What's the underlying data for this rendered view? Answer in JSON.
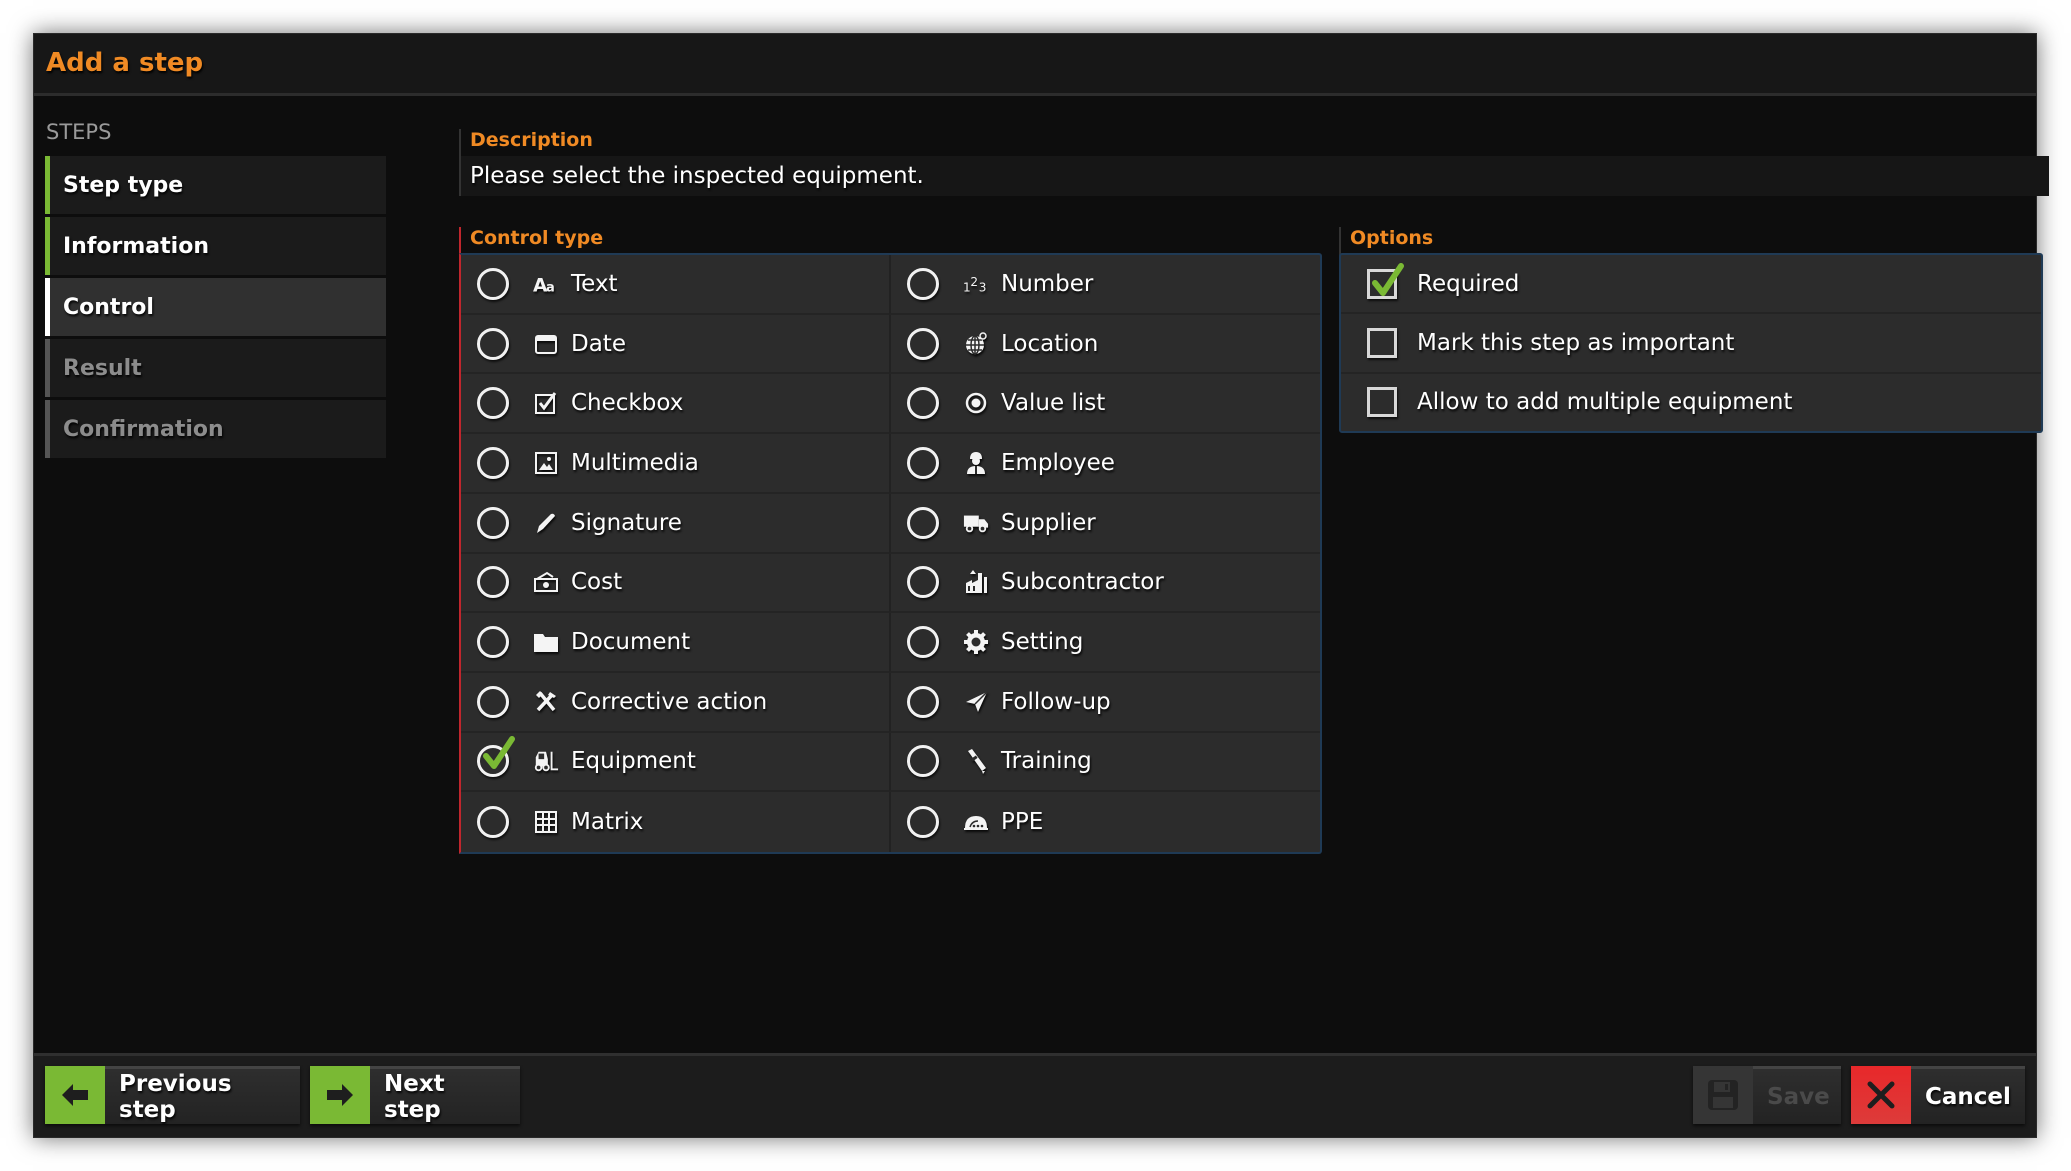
{
  "window": {
    "title": "Add a step"
  },
  "sidebar": {
    "heading": "STEPS",
    "items": [
      {
        "label": "Step type",
        "state": "done"
      },
      {
        "label": "Information",
        "state": "done"
      },
      {
        "label": "Control",
        "state": "active"
      },
      {
        "label": "Result",
        "state": "pending"
      },
      {
        "label": "Confirmation",
        "state": "pending"
      }
    ]
  },
  "description": {
    "label": "Description",
    "value": "Please select the inspected equipment."
  },
  "control_type": {
    "label": "Control type",
    "selected": "Equipment",
    "options": [
      {
        "label": "Text",
        "icon": "text-format-icon",
        "checked": false
      },
      {
        "label": "Date",
        "icon": "calendar-icon",
        "checked": false
      },
      {
        "label": "Checkbox",
        "icon": "checkbox-icon",
        "checked": false
      },
      {
        "label": "Multimedia",
        "icon": "image-icon",
        "checked": false
      },
      {
        "label": "Signature",
        "icon": "pen-icon",
        "checked": false
      },
      {
        "label": "Cost",
        "icon": "money-icon",
        "checked": false
      },
      {
        "label": "Document",
        "icon": "folder-icon",
        "checked": false
      },
      {
        "label": "Corrective action",
        "icon": "tools-icon",
        "checked": false
      },
      {
        "label": "Equipment",
        "icon": "forklift-icon",
        "checked": true
      },
      {
        "label": "Matrix",
        "icon": "grid-icon",
        "checked": false
      },
      {
        "label": "Number",
        "icon": "numbers-icon",
        "checked": false
      },
      {
        "label": "Location",
        "icon": "globe-pin-icon",
        "checked": false
      },
      {
        "label": "Value list",
        "icon": "radio-dot-icon",
        "checked": false
      },
      {
        "label": "Employee",
        "icon": "worker-icon",
        "checked": false
      },
      {
        "label": "Supplier",
        "icon": "truck-icon",
        "checked": false
      },
      {
        "label": "Subcontractor",
        "icon": "factory-icon",
        "checked": false
      },
      {
        "label": "Setting",
        "icon": "gear-icon",
        "checked": false
      },
      {
        "label": "Follow-up",
        "icon": "paper-plane-icon",
        "checked": false
      },
      {
        "label": "Training",
        "icon": "diploma-icon",
        "checked": false
      },
      {
        "label": "PPE",
        "icon": "hard-hat-icon",
        "checked": false
      }
    ]
  },
  "options": {
    "label": "Options",
    "items": [
      {
        "label": "Required",
        "checked": true
      },
      {
        "label": "Mark this step as important",
        "checked": false
      },
      {
        "label": "Allow to add multiple equipment",
        "checked": false
      }
    ]
  },
  "footer": {
    "previous_label": "Previous step",
    "next_label": "Next step",
    "save_label": "Save",
    "save_enabled": false,
    "cancel_label": "Cancel"
  },
  "colors": {
    "accent_orange": "#f08a24",
    "success_green": "#7ab934",
    "cancel_red": "#e8282a",
    "required_border_red": "#c0262d",
    "panel_border_blue": "#1f3a55"
  }
}
